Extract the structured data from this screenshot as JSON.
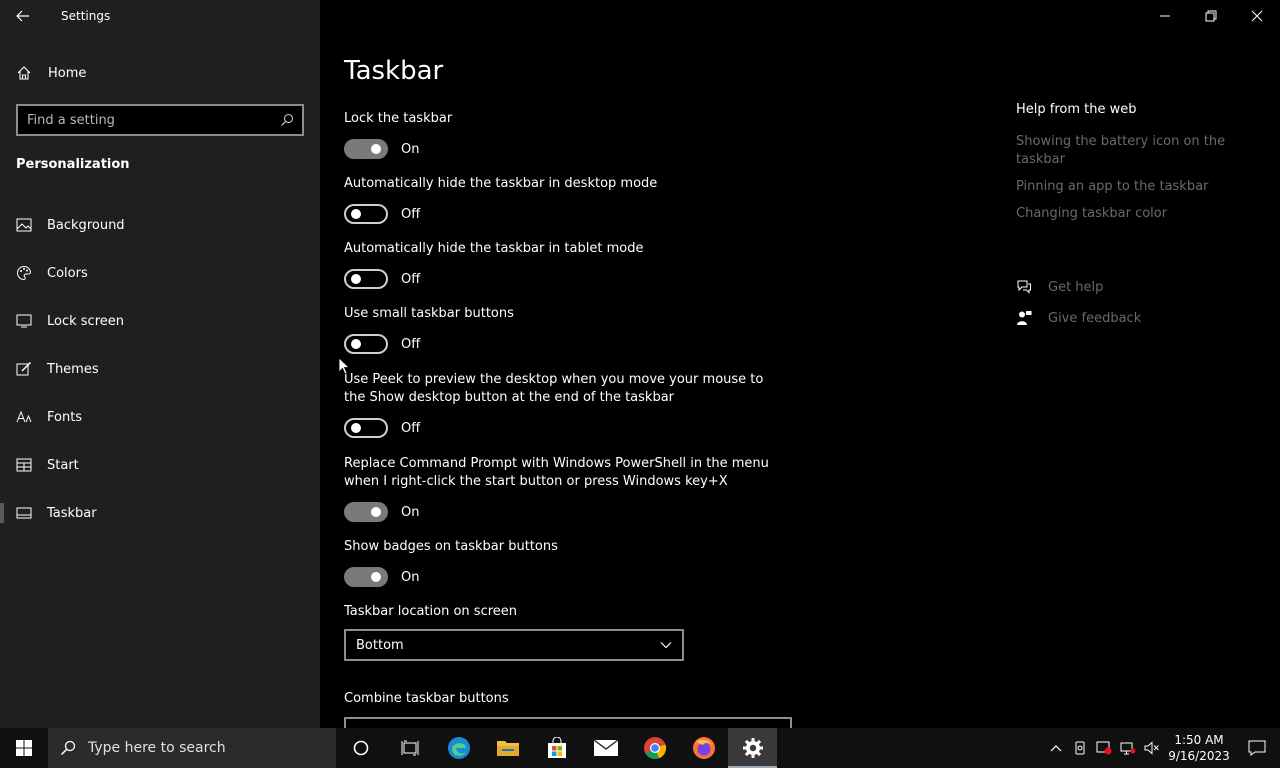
{
  "window": {
    "app_title": "Settings"
  },
  "sidebar": {
    "home_label": "Home",
    "search_placeholder": "Find a setting",
    "section_title": "Personalization",
    "items": [
      {
        "label": "Background",
        "icon": "image-icon"
      },
      {
        "label": "Colors",
        "icon": "palette-icon"
      },
      {
        "label": "Lock screen",
        "icon": "monitor-icon"
      },
      {
        "label": "Themes",
        "icon": "brush-icon"
      },
      {
        "label": "Fonts",
        "icon": "font-icon"
      },
      {
        "label": "Start",
        "icon": "start-menu-icon"
      },
      {
        "label": "Taskbar",
        "icon": "taskbar-icon",
        "active": true
      }
    ]
  },
  "main": {
    "title": "Taskbar",
    "settings": [
      {
        "label": "Lock the taskbar",
        "state": "On"
      },
      {
        "label": "Automatically hide the taskbar in desktop mode",
        "state": "Off"
      },
      {
        "label": "Automatically hide the taskbar in tablet mode",
        "state": "Off"
      },
      {
        "label": "Use small taskbar buttons",
        "state": "Off"
      },
      {
        "label": "Use Peek to preview the desktop when you move your mouse to the Show desktop button at the end of the taskbar",
        "state": "Off"
      },
      {
        "label": "Replace Command Prompt with Windows PowerShell in the menu when I right-click the start button or press Windows key+X",
        "state": "On"
      },
      {
        "label": "Show badges on taskbar buttons",
        "state": "On"
      }
    ],
    "location": {
      "label": "Taskbar location on screen",
      "value": "Bottom"
    },
    "combine": {
      "label": "Combine taskbar buttons"
    }
  },
  "help": {
    "title": "Help from the web",
    "links": [
      "Showing the battery icon on the taskbar",
      "Pinning an app to the taskbar",
      "Changing taskbar color"
    ],
    "get_help": "Get help",
    "give_feedback": "Give feedback"
  },
  "taskbar": {
    "search_placeholder": "Type here to search",
    "time": "1:50 AM",
    "date": "9/16/2023"
  },
  "colors": {
    "sidebar_bg": "#1f1f1f",
    "main_bg": "#000000",
    "toggle_on": "#7a7a7a",
    "link_gray": "#6a6a6a"
  }
}
